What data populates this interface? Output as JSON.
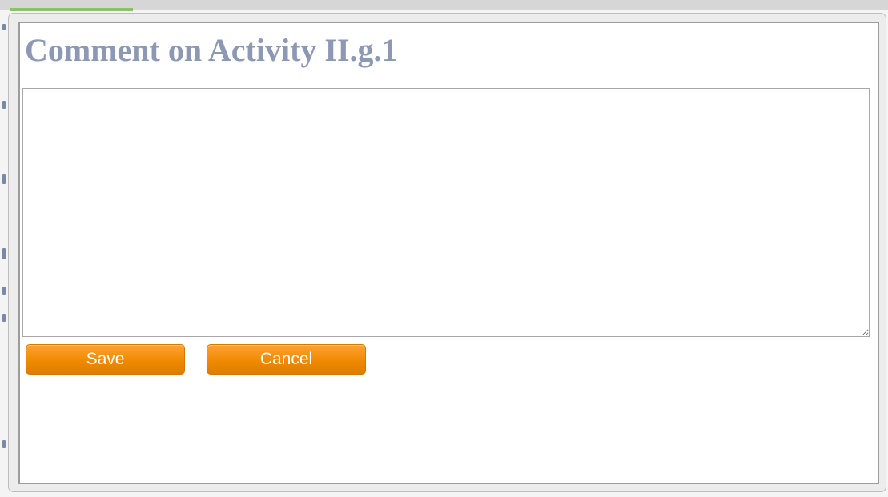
{
  "dialog": {
    "title": "Comment on Activity II.g.1",
    "comment": {
      "value": "",
      "placeholder": ""
    },
    "buttons": {
      "save_label": "Save",
      "cancel_label": "Cancel"
    }
  },
  "colors": {
    "title": "#8d98b5",
    "button": "#f08a00",
    "button_text": "#ffffff",
    "dialog_border": "#9c9c9c"
  },
  "icons": {
    "resize_handle": "resize-grip-icon"
  }
}
